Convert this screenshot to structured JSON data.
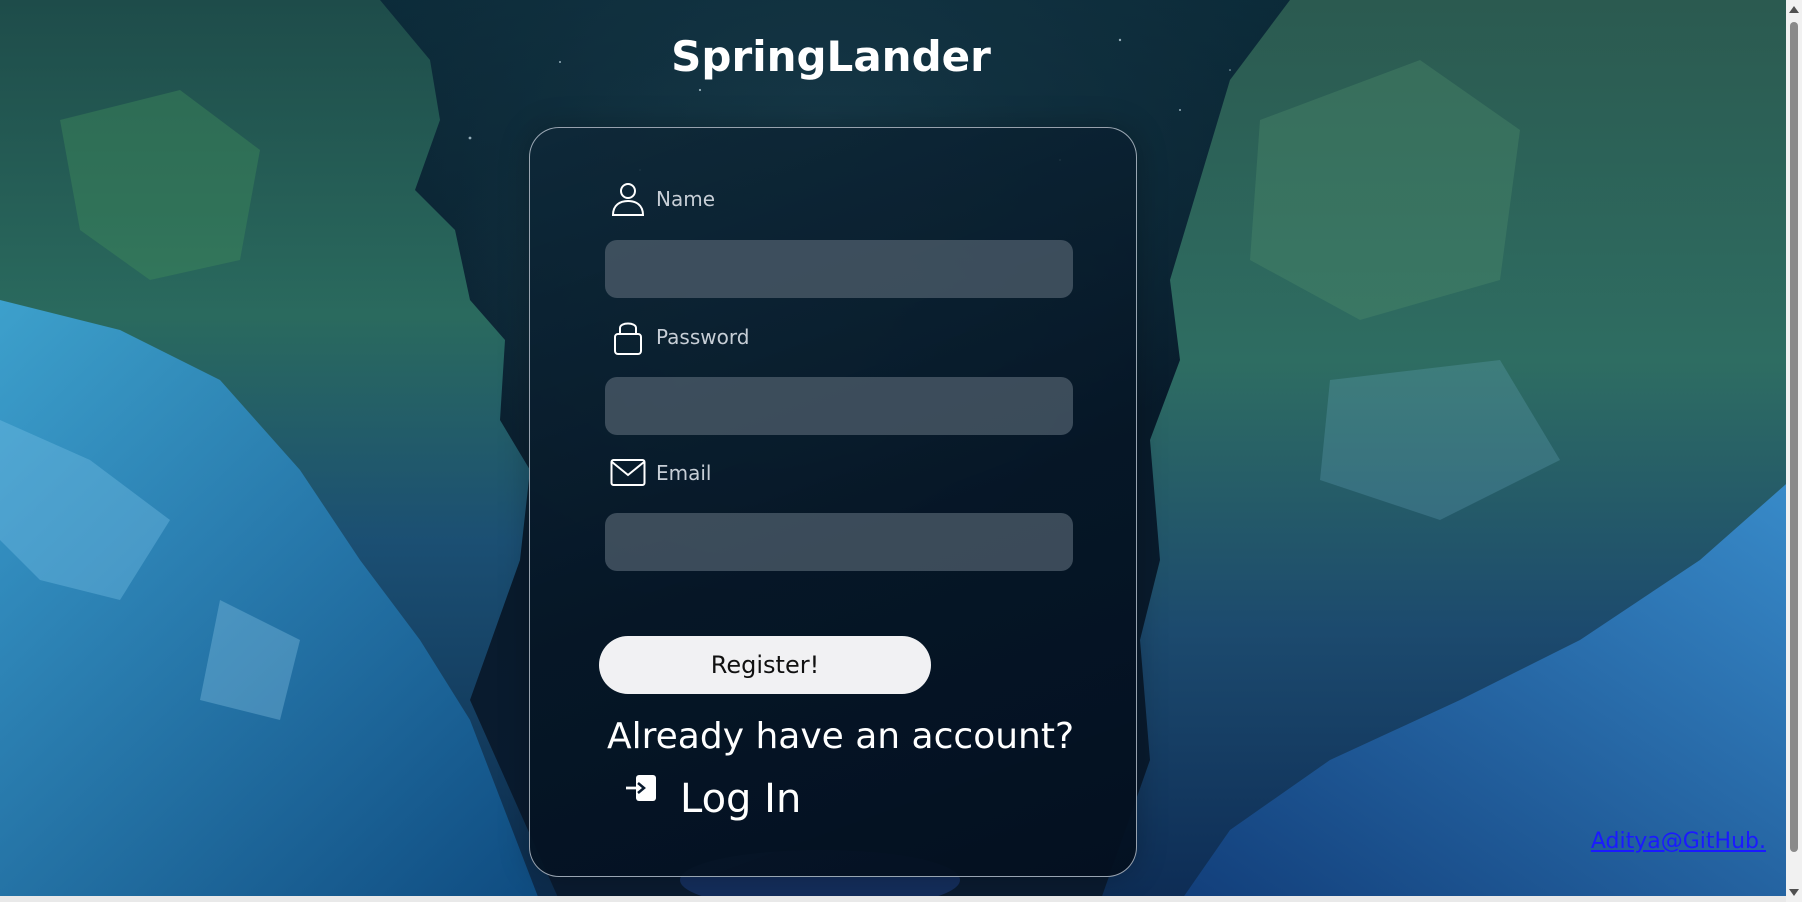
{
  "brand": {
    "title": "SpringLander"
  },
  "form": {
    "name_label": "Name",
    "password_label": "Password",
    "email_label": "Email",
    "name_value": "",
    "password_value": "",
    "email_value": "",
    "register_label": "Register!"
  },
  "login_prompt": {
    "text": "Already have an account?",
    "link_label": "Log In"
  },
  "footer": {
    "github_link": "Aditya@GitHub."
  },
  "icons": {
    "name": "user-icon",
    "password": "lock-icon",
    "email": "mail-icon",
    "login": "login-arrow-icon"
  },
  "colors": {
    "card_border": "#c8d2dc",
    "input_bg": "#505f6e",
    "button_bg": "#f1f1f3",
    "link": "#1a1aff"
  }
}
